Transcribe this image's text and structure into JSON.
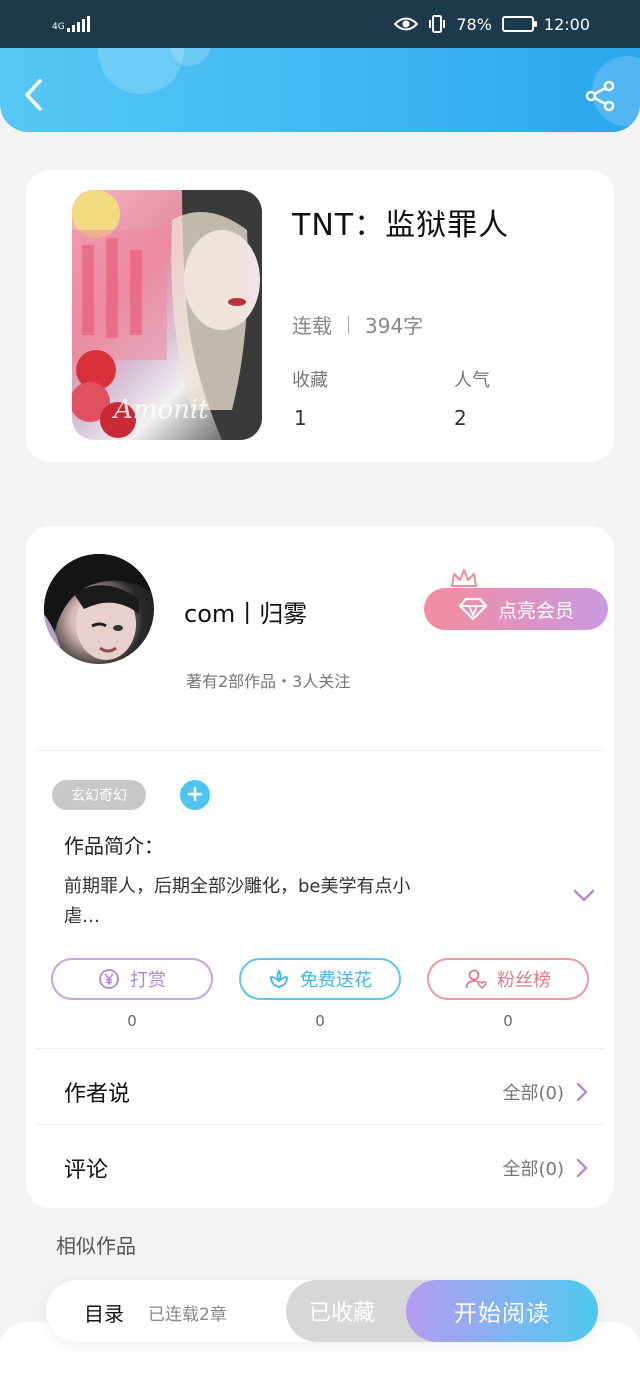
{
  "statusbar": {
    "network": "4G",
    "battery": "78%",
    "battery_level": 0.78,
    "time": "12:00",
    "colors": {
      "background": "#1d3a4a"
    }
  },
  "header": {
    "back_icon": "chevron-left-icon",
    "share_icon": "share-icon",
    "colors": {
      "gradient_start": "#56c8f5",
      "gradient_end": "#2aa6ee"
    }
  },
  "book": {
    "title": "TNT：监狱罪人",
    "status": "连载",
    "word_count": "394字",
    "favorites_label": "收藏",
    "favorites_value": "1",
    "popularity_label": "人气",
    "popularity_value": "2"
  },
  "author": {
    "name": "com丨归雾",
    "meta": "著有2部作品・3人关注",
    "vip_button": "点亮会员"
  },
  "tags": {
    "items": [
      "玄幻奇幻"
    ],
    "add_label": "+"
  },
  "intro": {
    "label": "作品简介：",
    "text": "前期罪人，后期全部沙雕化，be美学有点小虐…"
  },
  "actions": {
    "reward": {
      "label": "打赏",
      "count": "0"
    },
    "flower": {
      "label": "免费送花",
      "count": "0"
    },
    "fans": {
      "label": "粉丝榜",
      "count": "0"
    }
  },
  "rows": {
    "author_says": {
      "label": "作者说",
      "value": "全部(0)"
    },
    "comments": {
      "label": "评论",
      "value": "全部(0)"
    }
  },
  "similar": {
    "title": "相似作品"
  },
  "bottom": {
    "toc": "目录",
    "chapters": "已连载2章",
    "collected": "已收藏",
    "read": "开始阅读"
  }
}
